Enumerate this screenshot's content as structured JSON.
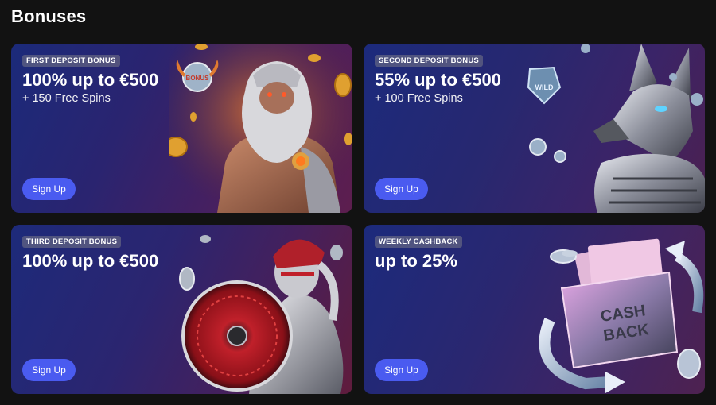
{
  "page": {
    "title": "Bonuses"
  },
  "cards": [
    {
      "badge": "FIRST DEPOSIT BONUS",
      "headline": "100% up to €500",
      "subline": "+ 150 Free Spins",
      "button": "Sign Up",
      "art": "zeus-illustration"
    },
    {
      "badge": "SECOND DEPOSIT BONUS",
      "headline": "55% up to €500",
      "subline": "+ 100 Free Spins",
      "button": "Sign Up",
      "art": "anubis-illustration"
    },
    {
      "badge": "THIRD DEPOSIT BONUS",
      "headline": "100% up to €500",
      "button": "Sign Up",
      "art": "athena-illustration"
    },
    {
      "badge": "WEEKLY CASHBACK",
      "headline": "up to 25%",
      "button": "Sign Up",
      "art": "cashback-wallet-illustration"
    }
  ],
  "art_text": {
    "zeus_coin": "BONUS",
    "anubis_gem": "WILD",
    "wallet_line1": "CASH",
    "wallet_line2": "BACK"
  },
  "colors": {
    "accent": "#4a5bf0",
    "background": "#121212"
  }
}
